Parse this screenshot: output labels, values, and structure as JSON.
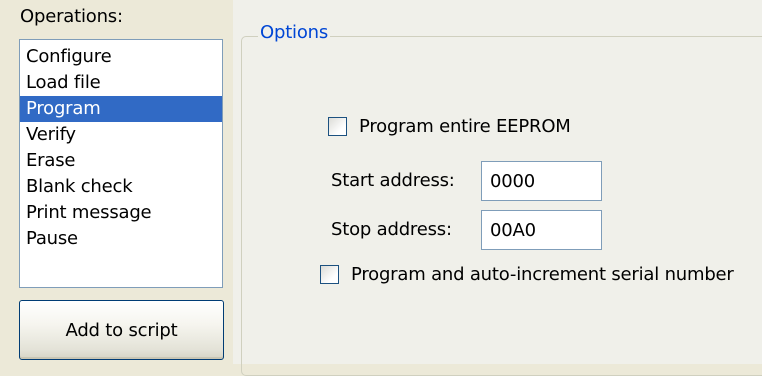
{
  "operations": {
    "label": "Operations:",
    "items": [
      {
        "label": "Configure"
      },
      {
        "label": "Load file"
      },
      {
        "label": "Program",
        "selected": true
      },
      {
        "label": "Verify"
      },
      {
        "label": "Erase"
      },
      {
        "label": "Blank check"
      },
      {
        "label": "Print message"
      },
      {
        "label": "Pause"
      }
    ],
    "add_button_label": "Add to script"
  },
  "options": {
    "title": "Options",
    "program_entire_eeprom": {
      "label": "Program entire EEPROM",
      "checked": false
    },
    "start_address": {
      "label": "Start address:",
      "value": "0000"
    },
    "stop_address": {
      "label": "Stop address:",
      "value": "00A0"
    },
    "auto_increment": {
      "label": "Program and auto-increment serial number",
      "checked": false
    }
  },
  "colors": {
    "selection": "#316ac5",
    "group_title": "#0046d5",
    "window_bg": "#ece9d8"
  }
}
